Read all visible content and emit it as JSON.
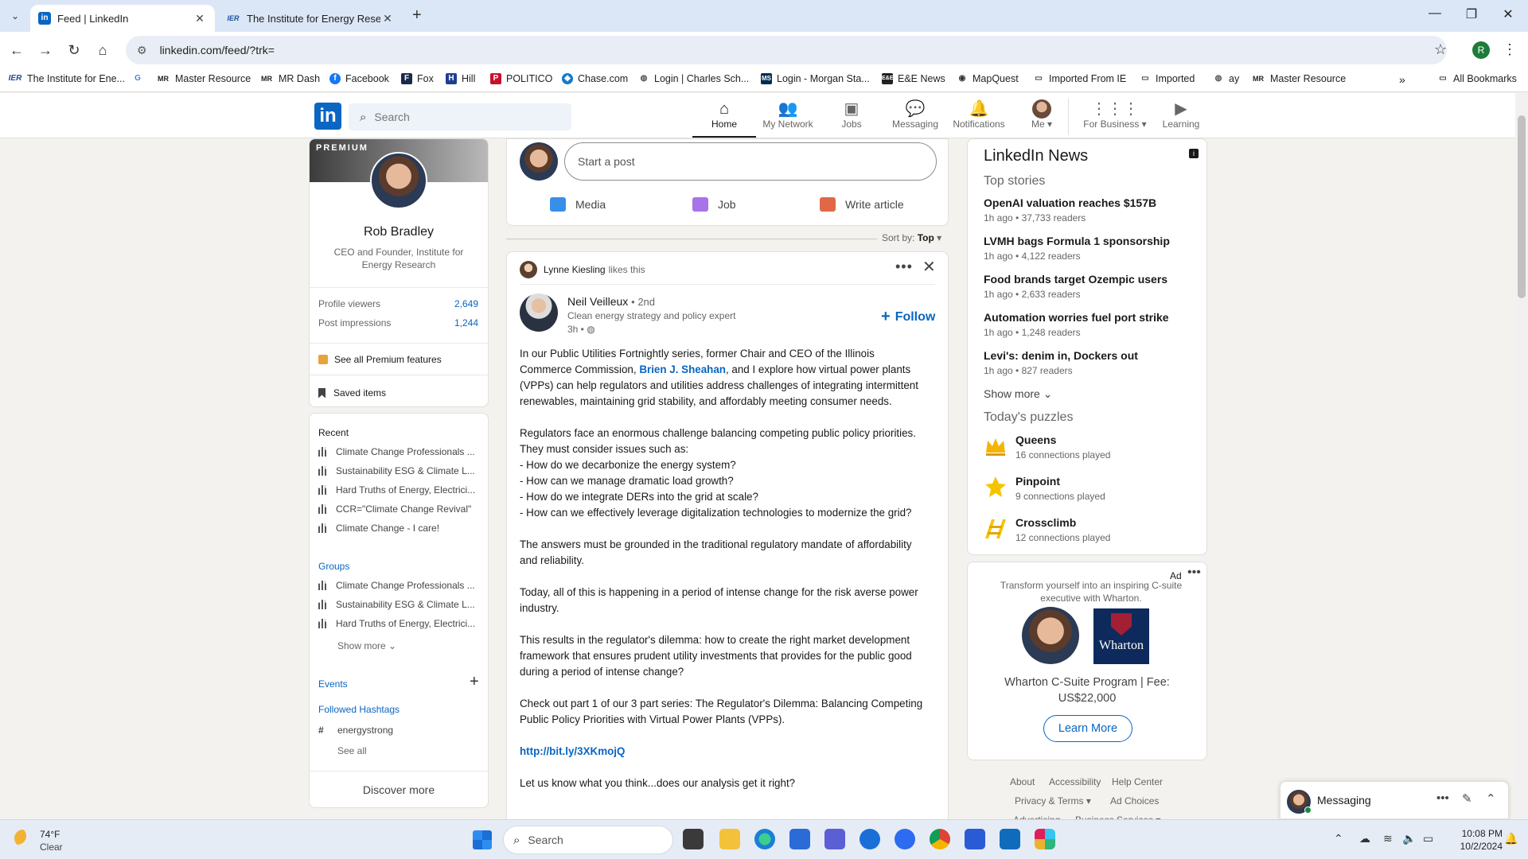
{
  "browser": {
    "tabs": [
      {
        "title": "Feed | LinkedIn",
        "favicon": "in",
        "active": true
      },
      {
        "title": "The Institute for Energy Researc",
        "favicon": "IER",
        "active": false
      }
    ],
    "url": "linkedin.com/feed/?trk=",
    "profile_initial": "R",
    "bookmarks": [
      {
        "label": "The Institute for Ene...",
        "icon": "IER"
      },
      {
        "label": "",
        "icon": "G"
      },
      {
        "label": "Master Resource",
        "icon": "MR"
      },
      {
        "label": "MR Dash",
        "icon": "MR"
      },
      {
        "label": "Facebook",
        "icon": "facebook-icon"
      },
      {
        "label": "Fox",
        "icon": "fox-icon"
      },
      {
        "label": "Hill",
        "icon": "hill-icon"
      },
      {
        "label": "POLITICO",
        "icon": "P"
      },
      {
        "label": "Chase.com",
        "icon": "chase-icon"
      },
      {
        "label": "Login | Charles Sch...",
        "icon": "globe-icon"
      },
      {
        "label": "Login - Morgan Sta...",
        "icon": "MS"
      },
      {
        "label": "E&E News",
        "icon": "E&E"
      },
      {
        "label": "MapQuest",
        "icon": "mapquest-icon"
      },
      {
        "label": "Imported From IE",
        "icon": "folder-icon"
      },
      {
        "label": "Imported",
        "icon": "folder-icon"
      },
      {
        "label": "ay",
        "icon": "globe-icon"
      },
      {
        "label": "Master Resource",
        "icon": "MR"
      }
    ],
    "all_bookmarks": "All Bookmarks"
  },
  "linkedin": {
    "logo": "in",
    "search_placeholder": "Search",
    "nav": [
      {
        "label": "Home",
        "icon": "home-icon",
        "active": true
      },
      {
        "label": "My Network",
        "icon": "network-icon"
      },
      {
        "label": "Jobs",
        "icon": "briefcase-icon"
      },
      {
        "label": "Messaging",
        "icon": "chat-icon"
      },
      {
        "label": "Notifications",
        "icon": "bell-icon"
      },
      {
        "label": "Me",
        "icon": "avatar"
      },
      {
        "label": "For Business",
        "icon": "grid-icon"
      },
      {
        "label": "Learning",
        "icon": "learning-icon"
      }
    ]
  },
  "profile": {
    "premium_label": "PREMIUM",
    "name": "Rob Bradley",
    "headline": "CEO and Founder, Institute for Energy Research",
    "stats": [
      {
        "label": "Profile viewers",
        "value": "2,649"
      },
      {
        "label": "Post impressions",
        "value": "1,244"
      }
    ],
    "premium_link": "See all Premium features",
    "saved_items": "Saved items"
  },
  "left": {
    "recent_title": "Recent",
    "recent": [
      "Climate Change Professionals ...",
      "Sustainability ESG & Climate L...",
      "Hard Truths of Energy, Electrici...",
      "CCR=\"Climate Change Revival\"",
      "Climate Change - I care!"
    ],
    "groups_title": "Groups",
    "groups": [
      "Climate Change Professionals ...",
      "Sustainability ESG & Climate L...",
      "Hard Truths of Energy, Electrici..."
    ],
    "show_more": "Show more",
    "events_title": "Events",
    "hashtags_title": "Followed Hashtags",
    "hashtags": [
      "energystrong"
    ],
    "see_all": "See all",
    "discover_more": "Discover more"
  },
  "composer": {
    "placeholder": "Start a post",
    "actions": [
      {
        "label": "Media",
        "icon": "image-icon",
        "color": "#378fe9"
      },
      {
        "label": "Job",
        "icon": "briefcase-icon",
        "color": "#a872e8"
      },
      {
        "label": "Write article",
        "icon": "article-icon",
        "color": "#e06847"
      }
    ]
  },
  "sort": {
    "label": "Sort by:",
    "value": "Top"
  },
  "post": {
    "liker": "Lynne Kiesling",
    "liker_action": "likes this",
    "author": "Neil Veilleux",
    "degree": "• 2nd",
    "headline": "Clean energy strategy and policy expert",
    "time": "3h •",
    "follow": "Follow",
    "p1a": "In our Public Utilities Fortnightly series, former Chair and CEO of the Illinois Commerce Commission, ",
    "p1_mention": "Brien J. Sheahan",
    "p1b": ", and I explore how virtual power plants (VPPs) can help regulators and utilities address challenges of integrating intermittent renewables, maintaining grid stability, and affordably meeting consumer needs.",
    "p2": "Regulators face an enormous challenge balancing competing public policy priorities. They must consider issues such as:",
    "bullets": [
      "- How do we decarbonize the energy system?",
      "- How can we manage dramatic load growth?",
      "- How do we integrate DERs into the grid at scale?",
      "- How can we effectively leverage digitalization technologies to modernize the grid?"
    ],
    "p3": "The answers must be grounded in the traditional regulatory mandate of affordability and reliability.",
    "p4": "Today, all of this is happening in a period of intense change for the risk averse power industry.",
    "p5": "This results in the regulator's dilemma: how to create the right market development framework that ensures prudent utility investments that provides for the public good during a period of intense change?",
    "p6": "Check out part 1 of our 3 part series: The Regulator's Dilemma: Balancing Competing Public Policy Priorities with Virtual Power Plants (VPPs).",
    "link": "http://bit.ly/3XKmojQ",
    "p7": "Let us know what you think...does our analysis get it right?"
  },
  "news": {
    "title": "LinkedIn News",
    "top_stories": "Top stories",
    "stories": [
      {
        "title": "OpenAI valuation reaches $157B",
        "meta": "1h ago • 37,733 readers"
      },
      {
        "title": "LVMH bags Formula 1 sponsorship",
        "meta": "1h ago • 4,122 readers"
      },
      {
        "title": "Food brands target Ozempic users",
        "meta": "1h ago • 2,633 readers"
      },
      {
        "title": "Automation worries fuel port strike",
        "meta": "1h ago • 1,248 readers"
      },
      {
        "title": "Levi's: denim in, Dockers out",
        "meta": "1h ago • 827 readers"
      }
    ],
    "show_more": "Show more",
    "puzzles_title": "Today's puzzles",
    "puzzles": [
      {
        "name": "Queens",
        "played": "16 connections played",
        "icon": "crown-icon"
      },
      {
        "name": "Pinpoint",
        "played": "9 connections played",
        "icon": "pinpoint-icon"
      },
      {
        "name": "Crossclimb",
        "played": "12 connections played",
        "icon": "crossclimb-icon"
      }
    ]
  },
  "ad": {
    "label": "Ad",
    "text": "Transform yourself into an inspiring C-suite executive with Wharton.",
    "logo_text": "Wharton",
    "title": "Wharton C-Suite Program | Fee: US$22,000",
    "cta": "Learn More"
  },
  "footer": {
    "links": [
      "About",
      "Accessibility",
      "Help Center",
      "Privacy & Terms",
      "Ad Choices",
      "Advertising",
      "Business Services"
    ]
  },
  "messaging": {
    "label": "Messaging"
  },
  "taskbar": {
    "temp": "74°F",
    "condition": "Clear",
    "search": "Search",
    "time": "10:08 PM",
    "date": "10/2/2024"
  }
}
